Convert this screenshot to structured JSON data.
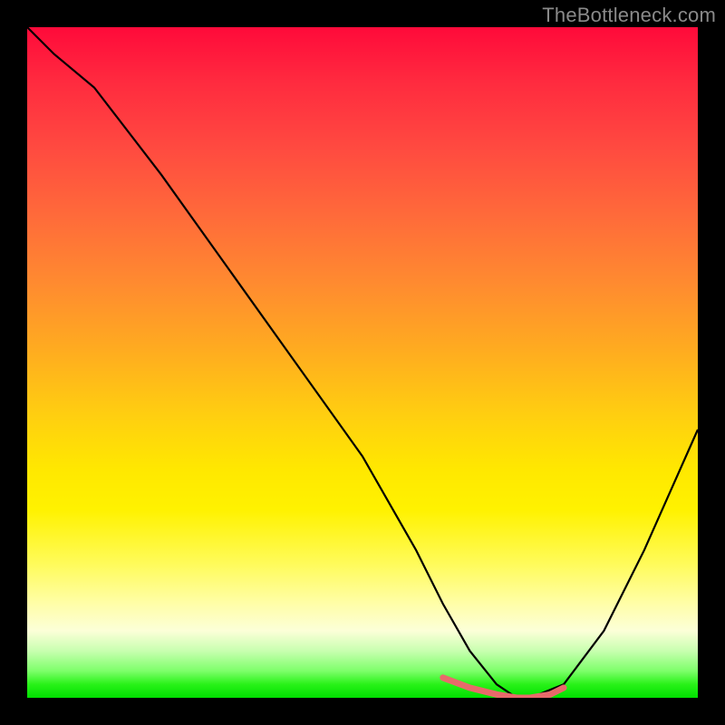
{
  "watermark": "TheBottleneck.com",
  "colors": {
    "frame": "#000000",
    "curve_stroke": "#000000",
    "valley_stroke": "#e86a6a",
    "watermark_text": "#8a8a8a"
  },
  "chart_data": {
    "type": "line",
    "title": "",
    "xlabel": "",
    "ylabel": "",
    "xlim": [
      0,
      100
    ],
    "ylim": [
      0,
      100
    ],
    "grid": false,
    "legend": false,
    "series": [
      {
        "name": "main-curve",
        "x": [
          0,
          4,
          10,
          20,
          30,
          40,
          50,
          58,
          62,
          66,
          70,
          73,
          75,
          80,
          86,
          92,
          100
        ],
        "y": [
          100,
          96,
          91,
          78,
          64,
          50,
          36,
          22,
          14,
          7,
          2,
          0,
          0,
          2,
          10,
          22,
          40
        ]
      }
    ],
    "valley_marker": {
      "name": "optimal-range",
      "x": [
        62,
        66,
        70,
        73,
        75,
        78,
        80
      ],
      "y": [
        3,
        1.5,
        0.5,
        0,
        0,
        0.5,
        1.5
      ]
    }
  }
}
